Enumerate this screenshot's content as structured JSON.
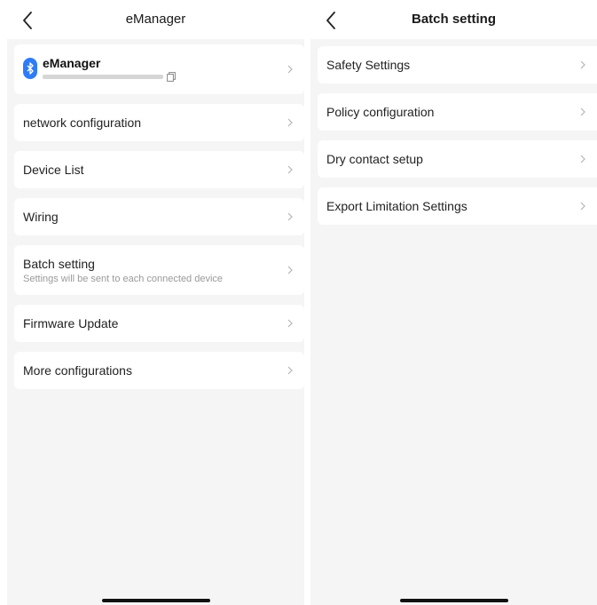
{
  "left": {
    "title": "eManager",
    "device": {
      "name": "eManager",
      "icon": "bluetooth-icon",
      "accent": "#2f7cf6"
    },
    "items": [
      {
        "label": "network configuration"
      },
      {
        "label": "Device List"
      },
      {
        "label": "Wiring"
      },
      {
        "label": "Batch setting",
        "subtitle": "Settings will be sent to each connected device"
      },
      {
        "label": "Firmware Update"
      },
      {
        "label": "More configurations"
      }
    ]
  },
  "right": {
    "title": "Batch setting",
    "items": [
      {
        "label": "Safety Settings"
      },
      {
        "label": "Policy configuration"
      },
      {
        "label": "Dry contact setup"
      },
      {
        "label": "Export Limitation Settings"
      }
    ]
  }
}
